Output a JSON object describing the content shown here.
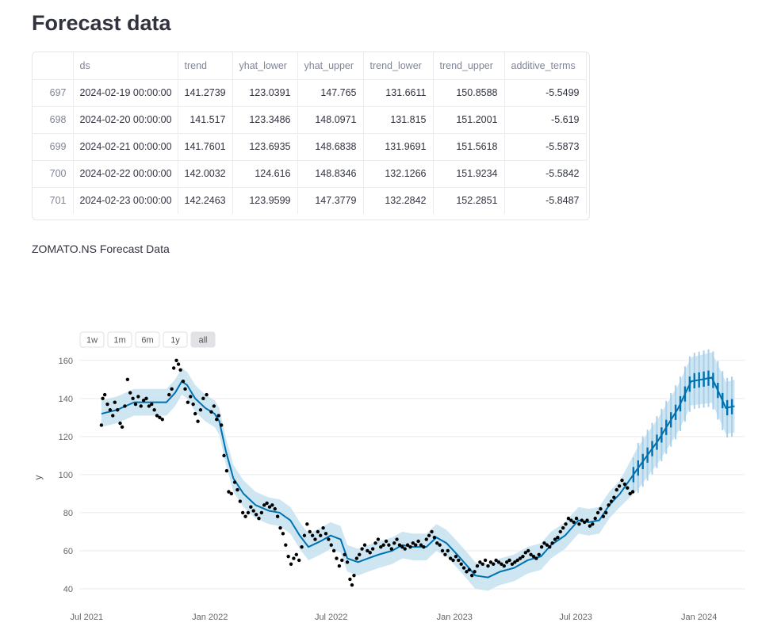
{
  "page": {
    "title": "Forecast data",
    "chart_title": "ZOMATO.NS Forecast Data"
  },
  "table": {
    "columns": [
      "",
      "ds",
      "trend",
      "yhat_lower",
      "yhat_upper",
      "trend_lower",
      "trend_upper",
      "additive_terms"
    ],
    "rows": [
      [
        "697",
        "2024-02-19 00:00:00",
        "141.2739",
        "123.0391",
        "147.765",
        "131.6611",
        "150.8588",
        "-5.5499"
      ],
      [
        "698",
        "2024-02-20 00:00:00",
        "141.517",
        "123.3486",
        "148.0971",
        "131.815",
        "151.2001",
        "-5.619"
      ],
      [
        "699",
        "2024-02-21 00:00:00",
        "141.7601",
        "123.6935",
        "148.6838",
        "131.9691",
        "151.5618",
        "-5.5873"
      ],
      [
        "700",
        "2024-02-22 00:00:00",
        "142.0032",
        "124.616",
        "148.8346",
        "132.1266",
        "151.9234",
        "-5.5842"
      ],
      [
        "701",
        "2024-02-23 00:00:00",
        "142.2463",
        "123.9599",
        "147.3779",
        "132.2842",
        "152.2851",
        "-5.8487"
      ]
    ]
  },
  "range_selector": {
    "buttons": [
      "1w",
      "1m",
      "6m",
      "1y",
      "all"
    ],
    "active": "all"
  },
  "chart_data": {
    "type": "line",
    "title": "",
    "xlabel": "",
    "ylabel": "y",
    "ylim": [
      35,
      162
    ],
    "xlim": [
      "2021-06-20",
      "2024-03-10"
    ],
    "x_ticks": [
      {
        "date": "2021-07-01",
        "label": "Jul 2021"
      },
      {
        "date": "2022-01-01",
        "label": "Jan 2022"
      },
      {
        "date": "2022-07-01",
        "label": "Jul 2022"
      },
      {
        "date": "2023-01-01",
        "label": "Jan 2023"
      },
      {
        "date": "2023-07-01",
        "label": "Jul 2023"
      },
      {
        "date": "2024-01-01",
        "label": "Jan 2024"
      }
    ],
    "y_ticks": [
      40,
      60,
      80,
      100,
      120,
      140,
      160
    ],
    "grid": true,
    "colors": {
      "forecast": "#0072b2",
      "band": "#c6e0f0",
      "actual": "#000000",
      "grid": "#eaeaea"
    },
    "series": [
      {
        "kind": "forecast",
        "points": [
          [
            "2021-07-23",
            132
          ],
          [
            "2021-08-15",
            134
          ],
          [
            "2021-09-10",
            138
          ],
          [
            "2021-10-10",
            138
          ],
          [
            "2021-10-28",
            138
          ],
          [
            "2021-11-10",
            143
          ],
          [
            "2021-11-20",
            149
          ],
          [
            "2021-11-28",
            147
          ],
          [
            "2021-12-10",
            140
          ],
          [
            "2021-12-25",
            135
          ],
          [
            "2022-01-08",
            132
          ],
          [
            "2022-01-15",
            128
          ],
          [
            "2022-01-25",
            112
          ],
          [
            "2022-02-05",
            98
          ],
          [
            "2022-02-20",
            90
          ],
          [
            "2022-03-10",
            84
          ],
          [
            "2022-03-30",
            81
          ],
          [
            "2022-04-15",
            80
          ],
          [
            "2022-05-01",
            76
          ],
          [
            "2022-05-15",
            68
          ],
          [
            "2022-05-28",
            62
          ],
          [
            "2022-06-15",
            65
          ],
          [
            "2022-06-30",
            68
          ],
          [
            "2022-07-15",
            66
          ],
          [
            "2022-07-25",
            56
          ],
          [
            "2022-08-10",
            54
          ],
          [
            "2022-08-25",
            56
          ],
          [
            "2022-09-10",
            58
          ],
          [
            "2022-09-30",
            60
          ],
          [
            "2022-10-15",
            63
          ],
          [
            "2022-10-31",
            62
          ],
          [
            "2022-11-20",
            62
          ],
          [
            "2022-12-05",
            67
          ],
          [
            "2022-12-20",
            64
          ],
          [
            "2023-01-05",
            58
          ],
          [
            "2023-01-20",
            52
          ],
          [
            "2023-02-01",
            47
          ],
          [
            "2023-02-20",
            46
          ],
          [
            "2023-03-10",
            49
          ],
          [
            "2023-03-31",
            51
          ],
          [
            "2023-04-20",
            55
          ],
          [
            "2023-05-10",
            57
          ],
          [
            "2023-05-25",
            63
          ],
          [
            "2023-06-15",
            68
          ],
          [
            "2023-07-05",
            76
          ],
          [
            "2023-07-20",
            75
          ],
          [
            "2023-08-05",
            76
          ],
          [
            "2023-08-20",
            84
          ],
          [
            "2023-09-05",
            90
          ],
          [
            "2023-10-01",
            103
          ],
          [
            "2023-11-01",
            118
          ],
          [
            "2023-12-01",
            135
          ],
          [
            "2023-12-20",
            149
          ],
          [
            "2024-01-05",
            150
          ],
          [
            "2024-01-20",
            151
          ],
          [
            "2024-02-01",
            142
          ],
          [
            "2024-02-10",
            135
          ],
          [
            "2024-02-23",
            136
          ]
        ]
      },
      {
        "kind": "actual",
        "points": [
          [
            "2021-07-23",
            126
          ],
          [
            "2021-07-25",
            140
          ],
          [
            "2021-07-28",
            142
          ],
          [
            "2021-08-01",
            137
          ],
          [
            "2021-08-05",
            134
          ],
          [
            "2021-08-09",
            131
          ],
          [
            "2021-08-12",
            138
          ],
          [
            "2021-08-16",
            134
          ],
          [
            "2021-08-20",
            127
          ],
          [
            "2021-08-23",
            125
          ],
          [
            "2021-08-27",
            136
          ],
          [
            "2021-08-31",
            150
          ],
          [
            "2021-09-04",
            143
          ],
          [
            "2021-09-08",
            140
          ],
          [
            "2021-09-12",
            137
          ],
          [
            "2021-09-16",
            141
          ],
          [
            "2021-09-20",
            136
          ],
          [
            "2021-09-24",
            139
          ],
          [
            "2021-09-28",
            140
          ],
          [
            "2021-10-02",
            136
          ],
          [
            "2021-10-06",
            137
          ],
          [
            "2021-10-10",
            134
          ],
          [
            "2021-10-14",
            131
          ],
          [
            "2021-10-18",
            130
          ],
          [
            "2021-10-22",
            129
          ],
          [
            "2021-11-01",
            142
          ],
          [
            "2021-11-05",
            145
          ],
          [
            "2021-11-08",
            156
          ],
          [
            "2021-11-12",
            160
          ],
          [
            "2021-11-15",
            158
          ],
          [
            "2021-11-18",
            155
          ],
          [
            "2021-11-22",
            149
          ],
          [
            "2021-11-25",
            145
          ],
          [
            "2021-11-29",
            138
          ],
          [
            "2021-12-03",
            141
          ],
          [
            "2021-12-07",
            137
          ],
          [
            "2021-12-10",
            132
          ],
          [
            "2021-12-14",
            128
          ],
          [
            "2021-12-18",
            134
          ],
          [
            "2021-12-22",
            140
          ],
          [
            "2021-12-27",
            142
          ],
          [
            "2022-01-03",
            133
          ],
          [
            "2022-01-07",
            136
          ],
          [
            "2022-01-11",
            129
          ],
          [
            "2022-01-14",
            131
          ],
          [
            "2022-01-18",
            126
          ],
          [
            "2022-01-22",
            110
          ],
          [
            "2022-01-26",
            102
          ],
          [
            "2022-01-29",
            91
          ],
          [
            "2022-02-02",
            90
          ],
          [
            "2022-02-07",
            96
          ],
          [
            "2022-02-11",
            92
          ],
          [
            "2022-02-15",
            86
          ],
          [
            "2022-02-19",
            80
          ],
          [
            "2022-02-23",
            78
          ],
          [
            "2022-02-27",
            80
          ],
          [
            "2022-03-03",
            83
          ],
          [
            "2022-03-07",
            81
          ],
          [
            "2022-03-11",
            79
          ],
          [
            "2022-03-15",
            77
          ],
          [
            "2022-03-19",
            80
          ],
          [
            "2022-03-23",
            84
          ],
          [
            "2022-03-27",
            85
          ],
          [
            "2022-03-31",
            83
          ],
          [
            "2022-04-04",
            84
          ],
          [
            "2022-04-08",
            82
          ],
          [
            "2022-04-12",
            78
          ],
          [
            "2022-04-16",
            72
          ],
          [
            "2022-04-20",
            69
          ],
          [
            "2022-04-24",
            63
          ],
          [
            "2022-04-28",
            57
          ],
          [
            "2022-05-02",
            53
          ],
          [
            "2022-05-06",
            56
          ],
          [
            "2022-05-10",
            58
          ],
          [
            "2022-05-14",
            55
          ],
          [
            "2022-05-18",
            62
          ],
          [
            "2022-05-22",
            68
          ],
          [
            "2022-05-26",
            74
          ],
          [
            "2022-05-30",
            70
          ],
          [
            "2022-06-03",
            68
          ],
          [
            "2022-06-07",
            66
          ],
          [
            "2022-06-11",
            70
          ],
          [
            "2022-06-15",
            68
          ],
          [
            "2022-06-19",
            72
          ],
          [
            "2022-06-23",
            69
          ],
          [
            "2022-06-27",
            66
          ],
          [
            "2022-07-01",
            63
          ],
          [
            "2022-07-05",
            60
          ],
          [
            "2022-07-09",
            56
          ],
          [
            "2022-07-13",
            52
          ],
          [
            "2022-07-17",
            55
          ],
          [
            "2022-07-21",
            58
          ],
          [
            "2022-07-25",
            54
          ],
          [
            "2022-07-29",
            45
          ],
          [
            "2022-08-01",
            42
          ],
          [
            "2022-08-04",
            47
          ],
          [
            "2022-08-08",
            56
          ],
          [
            "2022-08-12",
            58
          ],
          [
            "2022-08-16",
            61
          ],
          [
            "2022-08-20",
            63
          ],
          [
            "2022-08-24",
            60
          ],
          [
            "2022-08-28",
            59
          ],
          [
            "2022-09-01",
            61
          ],
          [
            "2022-09-05",
            64
          ],
          [
            "2022-09-09",
            66
          ],
          [
            "2022-09-13",
            62
          ],
          [
            "2022-09-17",
            63
          ],
          [
            "2022-09-21",
            65
          ],
          [
            "2022-09-25",
            63
          ],
          [
            "2022-09-29",
            61
          ],
          [
            "2022-10-03",
            64
          ],
          [
            "2022-10-07",
            66
          ],
          [
            "2022-10-11",
            63
          ],
          [
            "2022-10-15",
            62
          ],
          [
            "2022-10-19",
            61
          ],
          [
            "2022-10-23",
            63
          ],
          [
            "2022-10-27",
            62
          ],
          [
            "2022-10-31",
            64
          ],
          [
            "2022-11-04",
            63
          ],
          [
            "2022-11-08",
            65
          ],
          [
            "2022-11-12",
            63
          ],
          [
            "2022-11-16",
            62
          ],
          [
            "2022-11-20",
            66
          ],
          [
            "2022-11-24",
            68
          ],
          [
            "2022-11-28",
            70
          ],
          [
            "2022-12-02",
            67
          ],
          [
            "2022-12-06",
            64
          ],
          [
            "2022-12-10",
            63
          ],
          [
            "2022-12-14",
            60
          ],
          [
            "2022-12-18",
            58
          ],
          [
            "2022-12-22",
            60
          ],
          [
            "2022-12-26",
            56
          ],
          [
            "2022-12-30",
            55
          ],
          [
            "2023-01-03",
            57
          ],
          [
            "2023-01-07",
            55
          ],
          [
            "2023-01-11",
            53
          ],
          [
            "2023-01-15",
            51
          ],
          [
            "2023-01-19",
            49
          ],
          [
            "2023-01-23",
            50
          ],
          [
            "2023-01-27",
            47
          ],
          [
            "2023-01-31",
            49
          ],
          [
            "2023-02-04",
            52
          ],
          [
            "2023-02-08",
            54
          ],
          [
            "2023-02-12",
            53
          ],
          [
            "2023-02-16",
            55
          ],
          [
            "2023-02-20",
            52
          ],
          [
            "2023-02-24",
            54
          ],
          [
            "2023-02-28",
            53
          ],
          [
            "2023-03-04",
            55
          ],
          [
            "2023-03-08",
            54
          ],
          [
            "2023-03-12",
            53
          ],
          [
            "2023-03-16",
            52
          ],
          [
            "2023-03-20",
            54
          ],
          [
            "2023-03-24",
            55
          ],
          [
            "2023-03-28",
            53
          ],
          [
            "2023-04-01",
            54
          ],
          [
            "2023-04-05",
            55
          ],
          [
            "2023-04-09",
            56
          ],
          [
            "2023-04-13",
            57
          ],
          [
            "2023-04-17",
            59
          ],
          [
            "2023-04-21",
            60
          ],
          [
            "2023-04-25",
            58
          ],
          [
            "2023-04-29",
            57
          ],
          [
            "2023-05-03",
            56
          ],
          [
            "2023-05-07",
            58
          ],
          [
            "2023-05-11",
            62
          ],
          [
            "2023-05-15",
            64
          ],
          [
            "2023-05-19",
            63
          ],
          [
            "2023-05-23",
            62
          ],
          [
            "2023-05-27",
            64
          ],
          [
            "2023-05-31",
            66
          ],
          [
            "2023-06-04",
            67
          ],
          [
            "2023-06-08",
            70
          ],
          [
            "2023-06-12",
            72
          ],
          [
            "2023-06-16",
            74
          ],
          [
            "2023-06-20",
            77
          ],
          [
            "2023-06-24",
            76
          ],
          [
            "2023-06-28",
            75
          ],
          [
            "2023-07-02",
            77
          ],
          [
            "2023-07-06",
            74
          ],
          [
            "2023-07-10",
            76
          ],
          [
            "2023-07-14",
            75
          ],
          [
            "2023-07-18",
            76
          ],
          [
            "2023-07-22",
            73
          ],
          [
            "2023-07-26",
            74
          ],
          [
            "2023-07-30",
            77
          ],
          [
            "2023-08-03",
            80
          ],
          [
            "2023-08-07",
            82
          ],
          [
            "2023-08-11",
            78
          ],
          [
            "2023-08-15",
            80
          ],
          [
            "2023-08-19",
            84
          ],
          [
            "2023-08-23",
            86
          ],
          [
            "2023-08-27",
            88
          ],
          [
            "2023-08-31",
            92
          ],
          [
            "2023-09-04",
            94
          ],
          [
            "2023-09-08",
            97
          ],
          [
            "2023-09-12",
            95
          ],
          [
            "2023-09-16",
            93
          ],
          [
            "2023-09-20",
            90
          ],
          [
            "2023-09-24",
            91
          ]
        ]
      }
    ]
  }
}
